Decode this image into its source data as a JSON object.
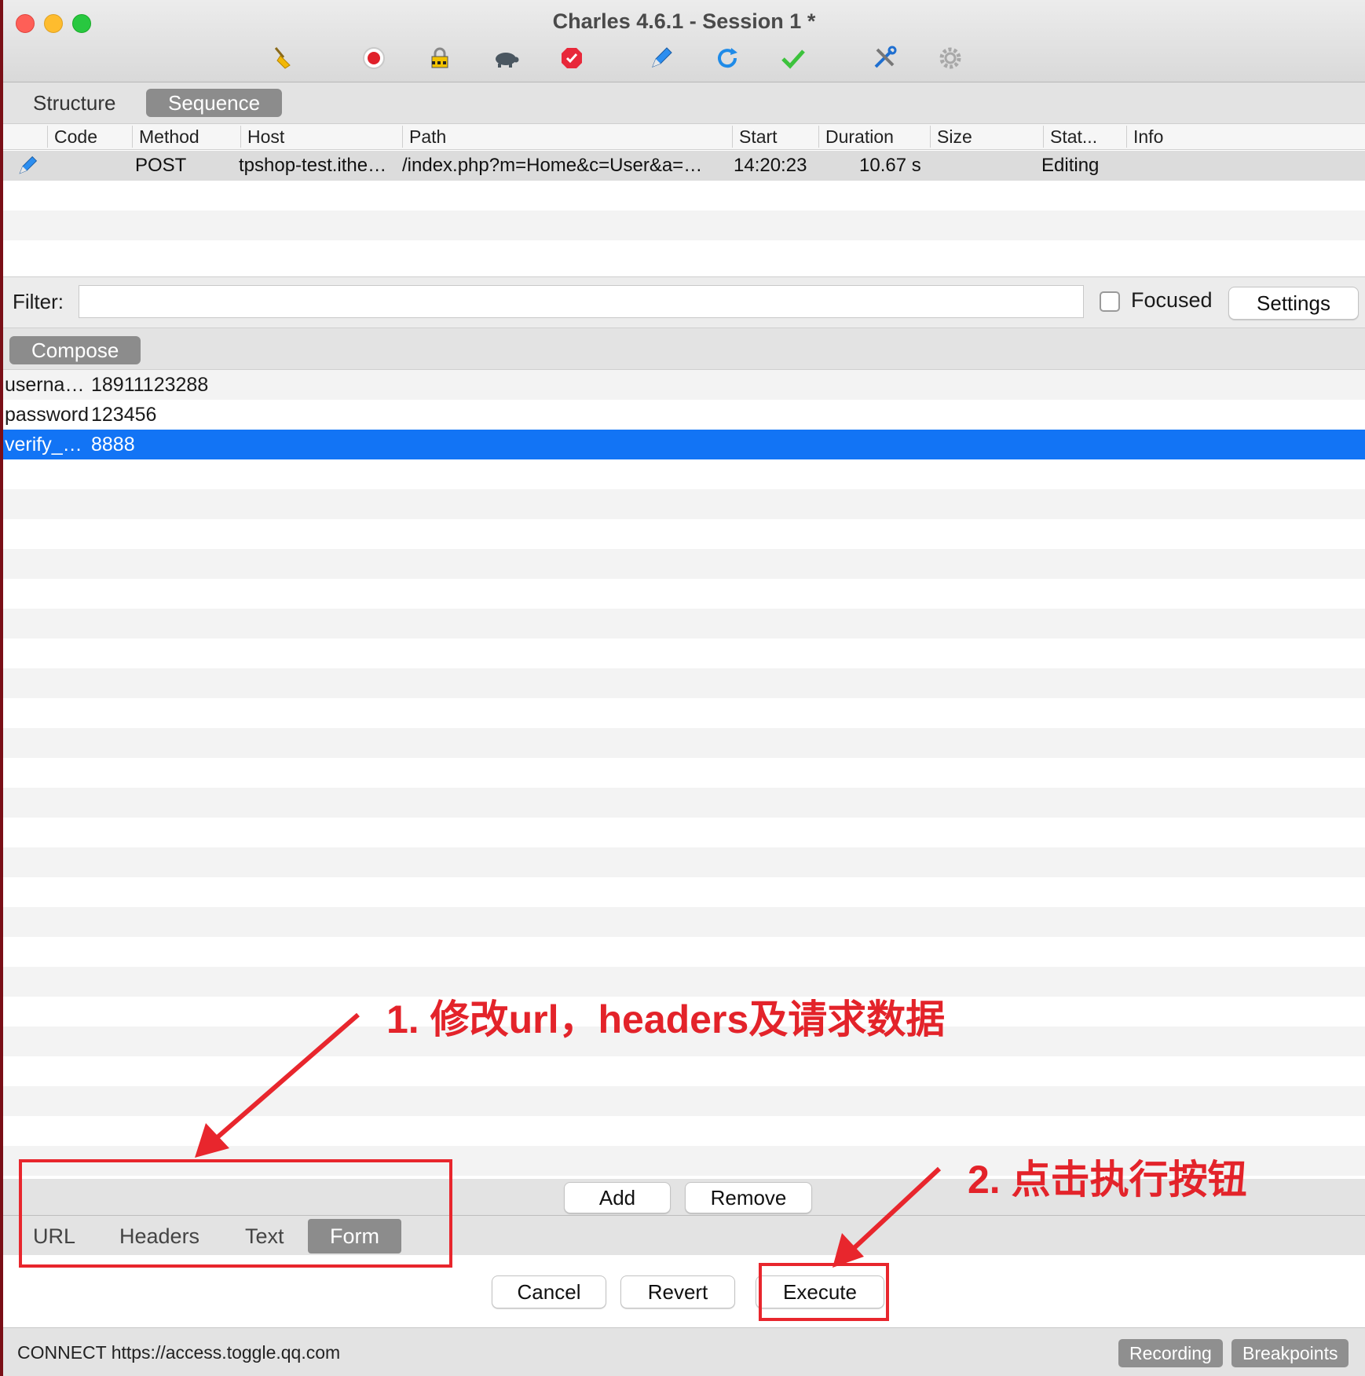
{
  "window": {
    "title": "Charles 4.6.1 - Session 1 *"
  },
  "toolbar": {
    "icons": [
      "broom-icon",
      "record-icon",
      "ssl-lock-icon",
      "throttle-turtle-icon",
      "breakpoint-stop-icon",
      "compose-pen-icon",
      "repeat-refresh-icon",
      "validate-check-icon",
      "tools-icon",
      "settings-gear-icon"
    ]
  },
  "view_tabs": [
    "Structure",
    "Sequence"
  ],
  "table": {
    "columns": [
      "Code",
      "Method",
      "Host",
      "Path",
      "Start",
      "Duration",
      "Size",
      "Stat...",
      "Info"
    ],
    "rows": [
      {
        "code": "",
        "method": "POST",
        "host": "tpshop-test.ithe…",
        "path": "/index.php?m=Home&c=User&a=…",
        "start": "14:20:23",
        "duration": "10.67 s",
        "size": "",
        "status": "Editing",
        "info": ""
      }
    ]
  },
  "filter": {
    "label": "Filter:",
    "value": "",
    "focused_label": "Focused",
    "settings_label": "Settings"
  },
  "compose": {
    "tab_label": "Compose"
  },
  "form": {
    "rows": [
      {
        "key": "userna…",
        "value": "18911123288"
      },
      {
        "key": "password",
        "value": "123456"
      },
      {
        "key": "verify_…",
        "value": "8888"
      }
    ],
    "add_label": "Add",
    "remove_label": "Remove"
  },
  "bottom_tabs": [
    "URL",
    "Headers",
    "Text",
    "Form"
  ],
  "actions": {
    "cancel": "Cancel",
    "revert": "Revert",
    "execute": "Execute"
  },
  "status": {
    "text": "CONNECT https://access.toggle.qq.com",
    "recording": "Recording",
    "breakpoints": "Breakpoints"
  },
  "annotations": {
    "step1": "1. 修改url，headers及请求数据",
    "step2": "2. 点击执行按钮",
    "color": "#e8262d"
  }
}
